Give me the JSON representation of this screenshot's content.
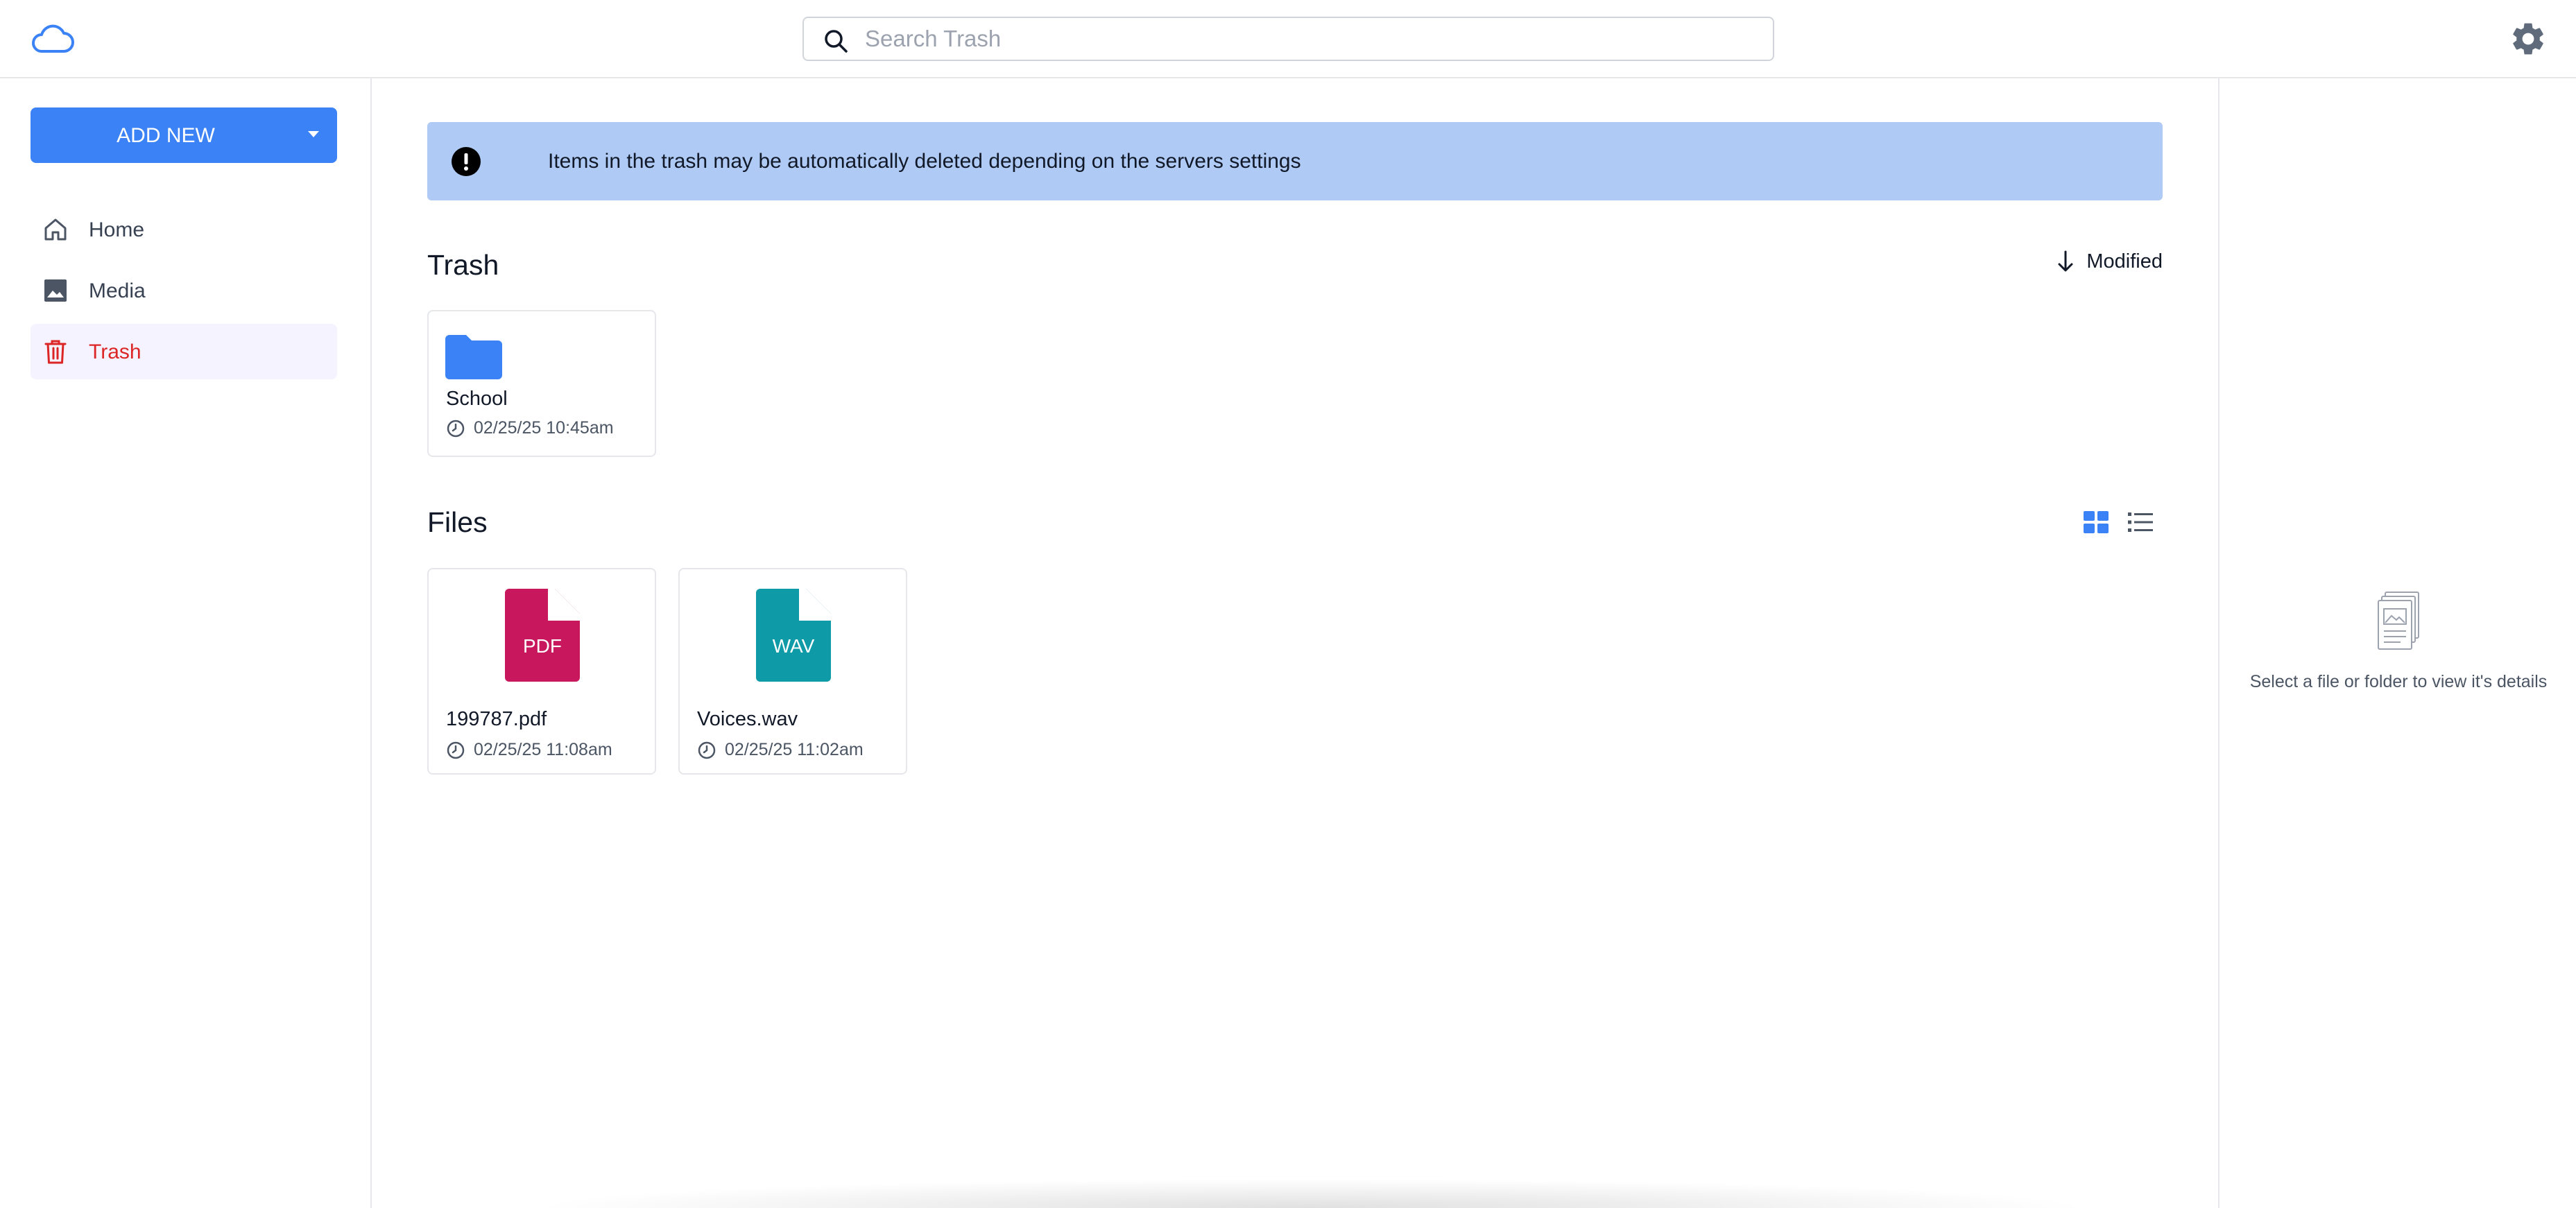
{
  "header": {
    "search_placeholder": "Search Trash"
  },
  "sidebar": {
    "add_new_label": "ADD NEW",
    "items": [
      {
        "label": "Home",
        "icon": "home-icon"
      },
      {
        "label": "Media",
        "icon": "image-icon"
      },
      {
        "label": "Trash",
        "icon": "trash-icon",
        "active": true
      }
    ]
  },
  "banner": {
    "text": "Items in the trash may be automatically deleted depending on the servers settings"
  },
  "trash_section": {
    "title": "Trash",
    "sort_label": "Modified",
    "folders": [
      {
        "name": "School",
        "date": "02/25/25 10:45am"
      }
    ]
  },
  "files_section": {
    "title": "Files",
    "files": [
      {
        "name": "199787.pdf",
        "badge": "PDF",
        "date": "02/25/25 11:08am",
        "color": "#c8175d"
      },
      {
        "name": "Voices.wav",
        "badge": "WAV",
        "date": "02/25/25 11:02am",
        "color": "#0e9aa7"
      }
    ]
  },
  "details": {
    "empty_text": "Select a file or folder to view it's details"
  },
  "colors": {
    "accent": "#3b82f6",
    "banner": "#afcbf5",
    "danger": "#dc2626"
  }
}
